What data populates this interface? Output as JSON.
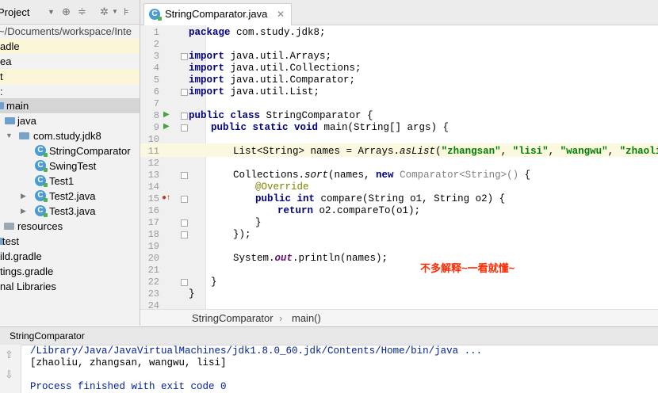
{
  "project_panel": {
    "toolbar_label": "Project",
    "path": "~/Documents/workspace/Inte",
    "tree": [
      {
        "label": "adle",
        "highlight": "yellow"
      },
      {
        "label": "ea",
        "highlight": "none"
      },
      {
        "label": "t",
        "highlight": "yellow"
      },
      {
        "label": ":",
        "highlight": "none"
      },
      {
        "label": "main",
        "highlight": "gray"
      },
      {
        "label": "java",
        "highlight": "none"
      },
      {
        "label": "com.study.jdk8",
        "highlight": "none"
      },
      {
        "label": "StringComparator",
        "highlight": "none"
      },
      {
        "label": "SwingTest",
        "highlight": "none"
      },
      {
        "label": "Test1",
        "highlight": "none"
      },
      {
        "label": "Test2.java",
        "highlight": "none"
      },
      {
        "label": "Test3.java",
        "highlight": "none"
      },
      {
        "label": "resources",
        "highlight": "none"
      },
      {
        "label": "test",
        "highlight": "none"
      },
      {
        "label": "ild.gradle",
        "highlight": "none"
      },
      {
        "label": "tings.gradle",
        "highlight": "none"
      },
      {
        "label": "nal Libraries",
        "highlight": "none"
      }
    ]
  },
  "editor": {
    "tab_label": "StringComparator.java",
    "class_icon_letter": "C",
    "line_numbers": [
      "1",
      "2",
      "3",
      "4",
      "5",
      "6",
      "7",
      "8",
      "9",
      "10",
      "11",
      "12",
      "13",
      "14",
      "15",
      "16",
      "17",
      "18",
      "19",
      "20",
      "21",
      "22",
      "23",
      "24"
    ],
    "code": {
      "l1_kw": "package",
      "l1_rest": " com.study.jdk8;",
      "import_kw": "import",
      "l3": " java.util.Arrays;",
      "l4": " java.util.Collections;",
      "l5": " java.util.Comparator;",
      "l6": " java.util.List;",
      "l8_kw": "public class",
      "l8_rest": " StringComparator {",
      "l9_kw": "public static void",
      "l9_rest": " main(String[] args) {",
      "l11_a": "List<String> names = Arrays.",
      "l11_method": "asList",
      "l11_b": "(",
      "l11_s1": "\"zhangsan\"",
      "l11_s2": "\"lisi\"",
      "l11_s3": "\"wangwu\"",
      "l11_s4": "\"zhaoliu\"",
      "comma": ", ",
      "l11_end": ");",
      "l13_a": "Collections.",
      "l13_method": "sort",
      "l13_b": "(names, ",
      "l13_new": "new",
      "l13_gray": " Comparator<String>()",
      "l13_end": " {",
      "l14": "@Override",
      "l15_kw1": "public",
      "l15_kw2": "int",
      "l15_rest": " compare(String o1, String o2) {",
      "l16_kw": "return",
      "l16_rest": " o2.compareTo(o1);",
      "l17": "}",
      "l18": "});",
      "l20_a": "System.",
      "l20_field": "out",
      "l20_b": ".println(names);",
      "l22": "}",
      "l23": "}"
    },
    "annotation_text": "不多解释~一看就懂~",
    "breadcrumb": {
      "class_name": "StringComparator",
      "separator": "›",
      "method": "main()"
    }
  },
  "run_panel": {
    "title": "StringComparator",
    "output": [
      "/Library/Java/JavaVirtualMachines/jdk1.8.0_60.jdk/Contents/Home/bin/java ...",
      "[zhaoliu, zhangsan, wangwu, lisi]",
      "",
      "Process finished with exit code 0"
    ]
  },
  "colors": {
    "keyword": "#000080",
    "string": "#008000",
    "annotation": "#808000",
    "highlight_line": "#fbf8e0",
    "callout": "#ff2a00"
  }
}
